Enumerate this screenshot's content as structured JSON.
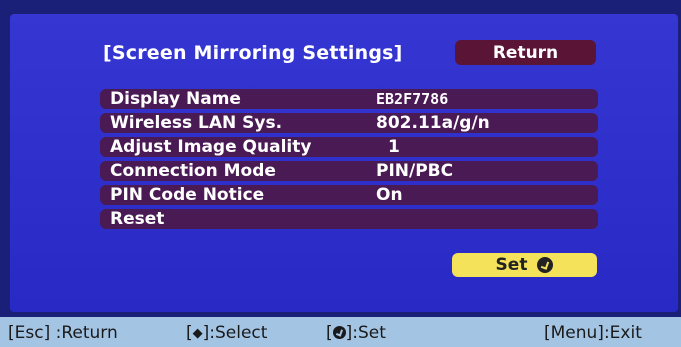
{
  "dialog": {
    "title": "[Screen Mirroring Settings]",
    "return_label": "Return",
    "set_label": "Set"
  },
  "settings": [
    {
      "label": "Display Name",
      "value": "EB2F7786"
    },
    {
      "label": "Wireless LAN Sys.",
      "value": "802.11a/g/n"
    },
    {
      "label": "Adjust Image Quality",
      "value": "1"
    },
    {
      "label": "Connection Mode",
      "value": "PIN/PBC"
    },
    {
      "label": "PIN Code Notice",
      "value": "On"
    },
    {
      "label": "Reset",
      "value": ""
    }
  ],
  "status_bar": {
    "esc_key": "[Esc]",
    "esc_action": ":Return",
    "select_open": "[",
    "select_close": "]:Select",
    "set_open": "[",
    "set_close": "]:Set",
    "menu_hint": "[Menu]:Exit"
  },
  "colors": {
    "screen_bg": "#2b2bd0",
    "row_bar": "#4a1a55",
    "return_button": "#5a1436",
    "set_button": "#f3e25a",
    "status_bar": "#a4c4e4"
  },
  "icons": {
    "select": "up-down-arrow-icon",
    "enter": "enter-icon"
  }
}
